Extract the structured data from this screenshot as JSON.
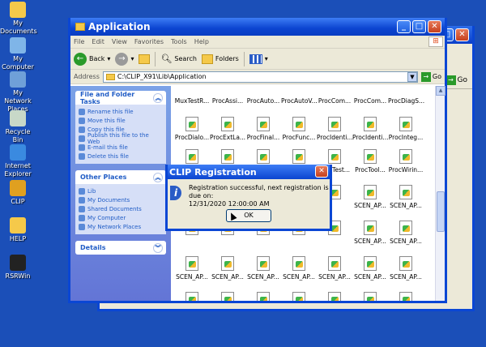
{
  "desktop": {
    "icons": [
      {
        "label": "My Documents",
        "color": "#f5c94a"
      },
      {
        "label": "My Computer",
        "color": "#7fb5e8"
      },
      {
        "label": "My Network Places",
        "color": "#6fa0d8"
      },
      {
        "label": "Recycle Bin",
        "color": "#c8d8c8"
      },
      {
        "label": "Internet Explorer",
        "color": "#3a8ae0"
      },
      {
        "label": "CLIP",
        "color": "#e0a020"
      },
      {
        "label": "HELP",
        "color": "#f5c94a"
      },
      {
        "label": "RSRWin",
        "color": "#222222"
      }
    ]
  },
  "window": {
    "title": "Application",
    "menu": [
      "File",
      "Edit",
      "View",
      "Favorites",
      "Tools",
      "Help"
    ],
    "toolbar": {
      "back": "Back",
      "search": "Search",
      "folders": "Folders"
    },
    "address": {
      "label": "Address",
      "path": "C:\\CLIP_X91\\Lib\\Application",
      "go": "Go"
    }
  },
  "background_window": {
    "go": "Go"
  },
  "sidebar": {
    "file_tasks": {
      "title": "File and Folder Tasks",
      "items": [
        "Rename this file",
        "Move this file",
        "Copy this file",
        "Publish this file to the Web",
        "E-mail this file",
        "Delete this file"
      ]
    },
    "other_places": {
      "title": "Other Places",
      "items": [
        "Lib",
        "My Documents",
        "Shared Documents",
        "My Computer",
        "My Network Places"
      ]
    },
    "details": {
      "title": "Details"
    }
  },
  "files": [
    [
      "MuxTestR...",
      "ProcAssi...",
      "ProcAuto...",
      "ProcAutoV...",
      "ProcCom...",
      "ProcCom...",
      "ProcDiagS..."
    ],
    [
      "ProcDialo...",
      "ProcExtLa...",
      "ProcFinal...",
      "ProcFunc...",
      "ProcIdenti...",
      "ProcIdenti...",
      "ProcInteg..."
    ],
    [
      "ProcMenu...",
      "ProcRena...",
      "ProcStart...",
      "ProcSyst...",
      "ProcTest...",
      "ProcTool...",
      "ProcWirin..."
    ],
    [
      "",
      "",
      "",
      "",
      "",
      "SCEN_AP...",
      "SCEN_AP..."
    ],
    [
      "",
      "",
      "",
      "",
      "",
      "SCEN_AP...",
      "SCEN_AP..."
    ],
    [
      "SCEN_AP...",
      "SCEN_AP...",
      "SCEN_AP...",
      "SCEN_AP...",
      "SCEN_AP...",
      "SCEN_AP...",
      "SCEN_AP..."
    ],
    [
      "SCEN_AP...",
      "SCEN_AP...",
      "SCEN_CM...",
      "SCEN_CO...",
      "SCEN_EC...",
      "SCEN_EC...",
      "SCEN_EC..."
    ]
  ],
  "dialog": {
    "title": "CLIP Registration",
    "message": "Registration successful, next registration is due on:",
    "date": "12/31/2020 12:00:00 AM",
    "ok": "OK"
  }
}
